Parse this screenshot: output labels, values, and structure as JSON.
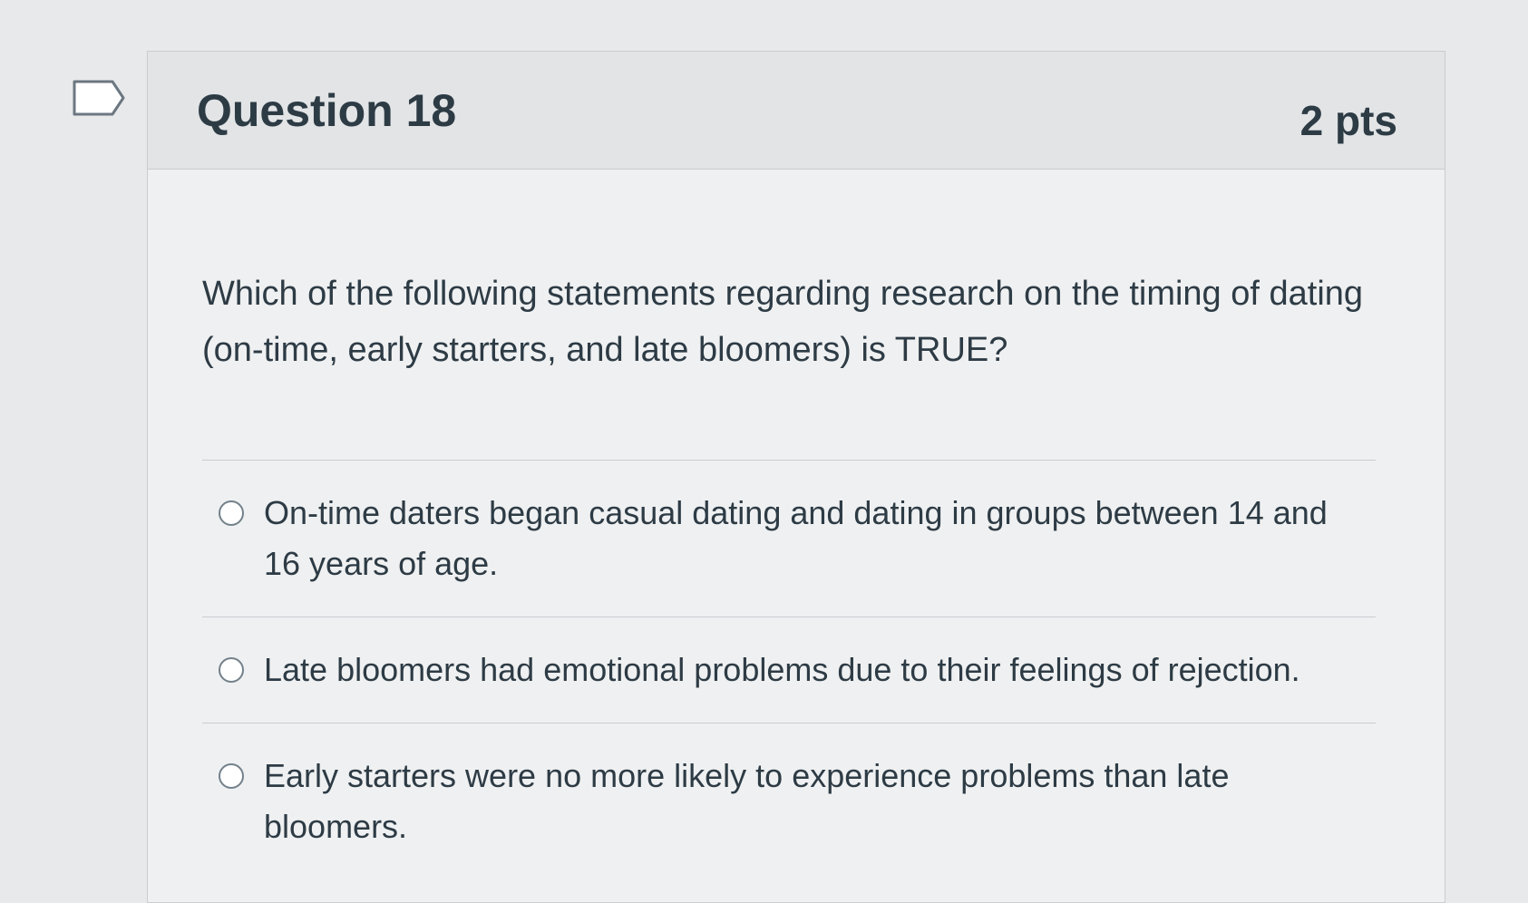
{
  "question": {
    "title": "Question 18",
    "points": "2 pts",
    "text": "Which of the following statements regarding research on the timing of dating (on-time, early starters, and late bloomers) is TRUE?",
    "flag_icon": "flag-outline-icon"
  },
  "answers": [
    {
      "label": "On-time daters began casual dating and dating in groups between 14 and 16 years of age.",
      "selected": false
    },
    {
      "label": "Late bloomers had emotional problems due to their feelings of rejection.",
      "selected": false
    },
    {
      "label": "Early starters were no more likely to experience problems than late bloomers.",
      "selected": false
    }
  ],
  "colors": {
    "page_background": "#e8e9ea",
    "card_background": "#eff0f1",
    "header_background": "#e2e4e6",
    "text": "#2d3b45",
    "border": "#c7cdd1"
  }
}
